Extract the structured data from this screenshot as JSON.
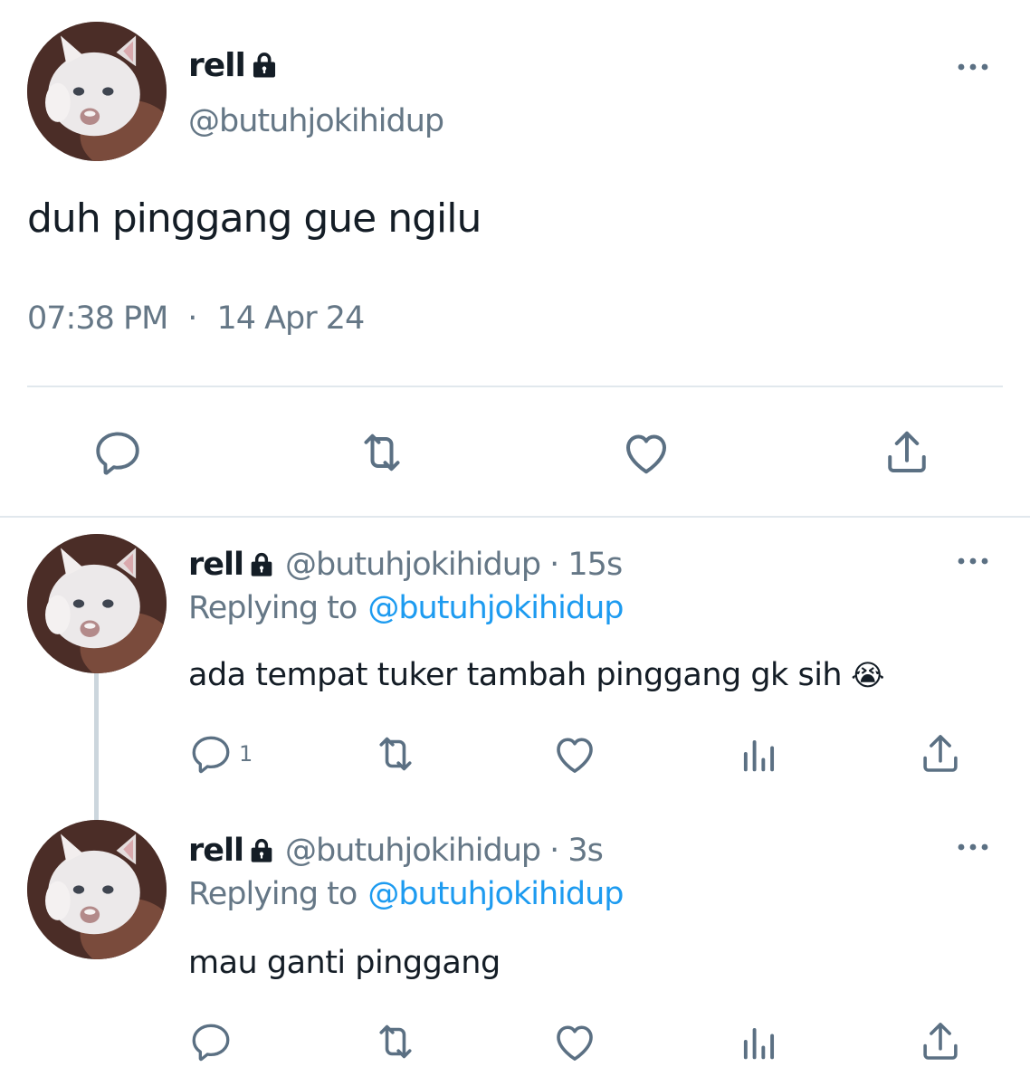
{
  "main_tweet": {
    "display_name": "rell",
    "handle": "@butuhjokihidup",
    "text": "duh pinggang gue ngilu",
    "time": "07:38 PM",
    "separator": "·",
    "date": "14 Apr 24"
  },
  "replies": [
    {
      "display_name": "rell",
      "handle": "@butuhjokihidup",
      "meta": "· 15s",
      "replying_prefix": "Replying to",
      "replying_handle": "@butuhjokihidup",
      "text": "ada tempat tuker tambah pinggang gk sih",
      "emoji": "😭",
      "reply_count": "1"
    },
    {
      "display_name": "rell",
      "handle": "@butuhjokihidup",
      "meta": "· 3s",
      "replying_prefix": "Replying to",
      "replying_handle": "@butuhjokihidup",
      "text": "mau ganti pinggang",
      "reply_count": ""
    }
  ],
  "colors": {
    "text": "#141d26",
    "secondary": "#657786",
    "accent": "#1d9bf0",
    "divider": "#e1e8ed",
    "icon": "#5b7083"
  },
  "icons": [
    "lock-icon",
    "more-icon",
    "reply-icon",
    "retweet-icon",
    "like-icon",
    "share-icon",
    "analytics-icon"
  ]
}
